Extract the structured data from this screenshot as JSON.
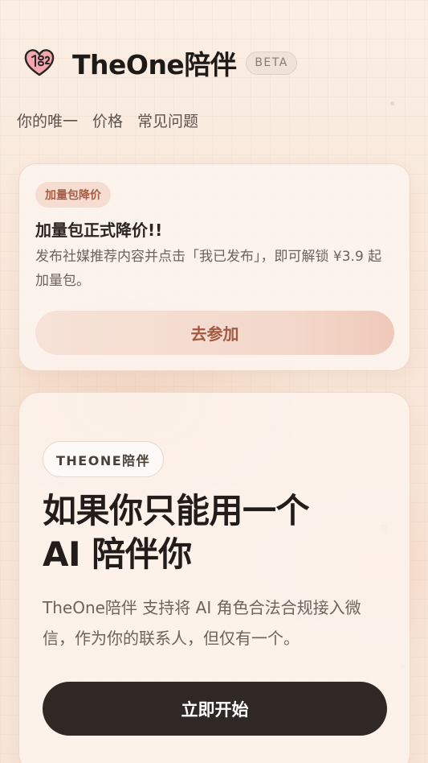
{
  "header": {
    "logo_icon": "heart-logo-icon",
    "brand": "TheOne陪伴",
    "badge": "BETA"
  },
  "nav": {
    "items": [
      "你的唯一",
      "价格",
      "常见问题"
    ]
  },
  "promo": {
    "tag": "加量包降价",
    "title": "加量包正式降价!!",
    "description": "发布社媒推荐内容并点击「我已发布」，即可解锁 ¥3.9 起加量包。",
    "button": "去参加"
  },
  "hero": {
    "tag": "THEONE陪伴",
    "title_line1": "如果你只能用一个",
    "title_line2": "AI 陪伴你",
    "description": "TheOne陪伴 支持将 AI 角色合法合规接入微信，作为你的联系人，但仅有一个。",
    "button": "立即开始"
  },
  "colors": {
    "primary_dark": "#2f2824",
    "accent": "#a75d46",
    "background": "#f8e7da"
  }
}
